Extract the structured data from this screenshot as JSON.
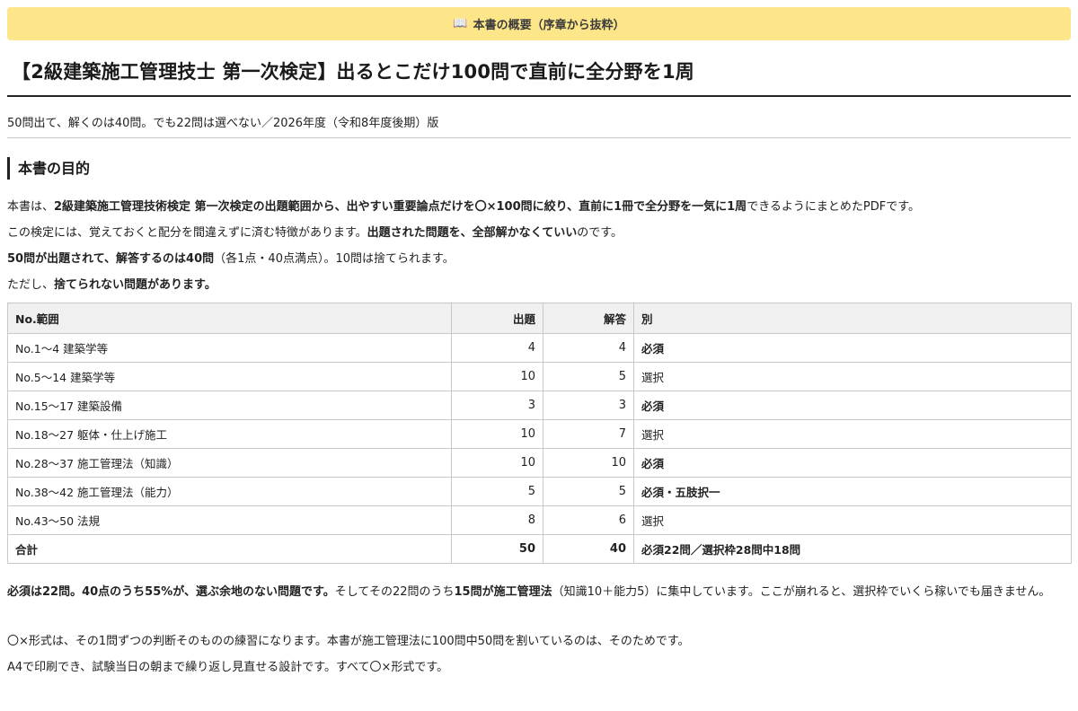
{
  "banner": {
    "icon": "open-book-icon",
    "text": "本書の概要（序章から抜粋）"
  },
  "title": "【2級建築施工管理技士 第一次検定】出るとこだけ100問で直前に全分野を1周",
  "subtitle": "50問出て、解くのは40問。でも22問は選べない／2026年度（令和8年度後期）版",
  "section_heading": "本書の目的",
  "p1": {
    "a": "本書は、",
    "b": "2級建築施工管理技術検定 第一次検定の出題範囲から、出やすい重要論点だけを〇×100問に絞り、直前に1冊で全分野を一気に1周",
    "c": "できるようにまとめたPDFです。"
  },
  "p2": {
    "a": "この検定には、覚えておくと配分を間違えずに済む特徴があります。",
    "b": "出題された問題を、全部解かなくていい",
    "c": "のです。"
  },
  "p3": {
    "a": "50問が出題されて、解答するのは40問",
    "b": "（各1点・40点満点）。10問は捨てられます。"
  },
  "p4": {
    "a": "ただし、",
    "b": "捨てられない問題があります。"
  },
  "table": {
    "headers": [
      "No.範囲",
      "出題",
      "解答",
      "別"
    ],
    "rows": [
      {
        "range": "No.1〜4 建築学等",
        "asked": "4",
        "answered": "4",
        "type": "必須",
        "type_bold": true
      },
      {
        "range": "No.5〜14 建築学等",
        "asked": "10",
        "answered": "5",
        "type": "選択",
        "type_bold": false
      },
      {
        "range": "No.15〜17 建築設備",
        "asked": "3",
        "answered": "3",
        "type": "必須",
        "type_bold": true
      },
      {
        "range": "No.18〜27 躯体・仕上げ施工",
        "asked": "10",
        "answered": "7",
        "type": "選択",
        "type_bold": false
      },
      {
        "range": "No.28〜37 施工管理法（知識）",
        "asked": "10",
        "answered": "10",
        "type": "必須",
        "type_bold": true
      },
      {
        "range": "No.38〜42 施工管理法（能力）",
        "asked": "5",
        "answered": "5",
        "type": "必須・五肢択一",
        "type_bold": true
      },
      {
        "range": "No.43〜50 法規",
        "asked": "8",
        "answered": "6",
        "type": "選択",
        "type_bold": false
      }
    ],
    "total": {
      "range": "合計",
      "asked": "50",
      "answered": "40",
      "type": "必須22問／選択枠28問中18問"
    }
  },
  "p5": {
    "a": "必須は22問。40点のうち55%が、選ぶ余地のない問題です。",
    "b": "そしてその22問のうち",
    "c": "15問が施工管理法",
    "d": "（知識10＋能力5）に集中しています。ここが崩れると、選択枠でいくら稼いでも届きません。"
  },
  "p6": "〇×形式は、その1問ずつの判断そのものの練習になります。本書が施工管理法に100問中50問を割いているのは、そのためです。",
  "p7": "A4で印刷でき、試験当日の朝まで繰り返し見直せる設計です。すべて〇×形式です。"
}
